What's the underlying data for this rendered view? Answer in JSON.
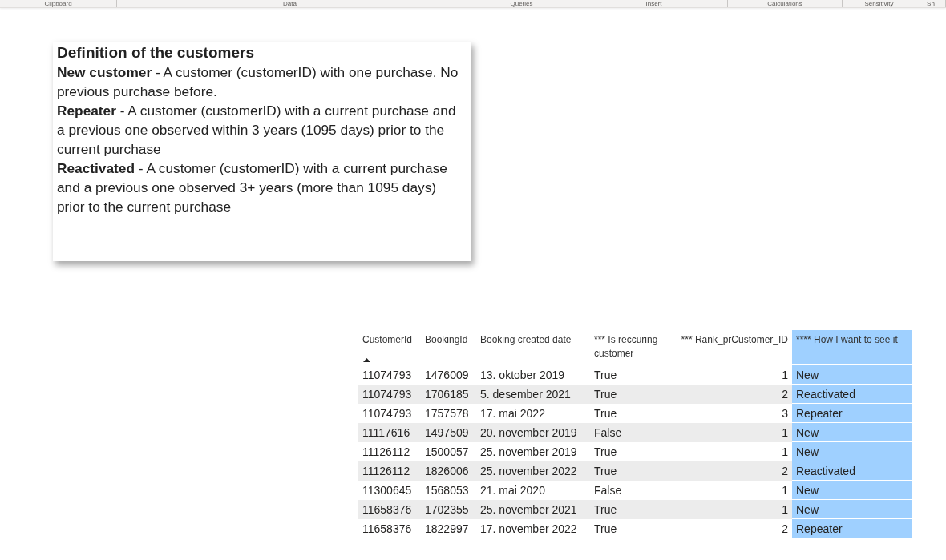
{
  "ribbon": {
    "groups": [
      "Clipboard",
      "Data",
      "Queries",
      "Insert",
      "Calculations",
      "Sensitivity",
      "Sh"
    ]
  },
  "definitions": {
    "title": "Definition of the customers",
    "paragraphs": [
      "**New customer** - A customer (customerID) with one purchase. No previous purchase before.",
      "**Repeater** - A customer (customerID) with a current purchase and a previous one observed within 3 years (1095 days) prior to the current purchase",
      "**Reactivated** - A customer (customerID) with a current purchase and a previous one observed 3+ years (more than 1095 days) prior to the current purchase"
    ]
  },
  "table": {
    "columns": [
      {
        "label": "CustomerId",
        "sorted": true,
        "highlighted": false,
        "kind": "text"
      },
      {
        "label": "BookingId",
        "sorted": false,
        "highlighted": false,
        "kind": "text"
      },
      {
        "label": "Booking created date",
        "sorted": false,
        "highlighted": false,
        "kind": "text"
      },
      {
        "label": "*** Is reccuring customer",
        "sorted": false,
        "highlighted": false,
        "kind": "text"
      },
      {
        "label": "*** Rank_prCustomer_ID",
        "sorted": false,
        "highlighted": false,
        "kind": "number"
      },
      {
        "label": "**** How I want to see it",
        "sorted": false,
        "highlighted": true,
        "kind": "text"
      }
    ],
    "rows": [
      [
        "11074793",
        "1476009",
        "13. oktober 2019",
        "True",
        "1",
        "New"
      ],
      [
        "11074793",
        "1706185",
        "5. desember 2021",
        "True",
        "2",
        "Reactivated"
      ],
      [
        "11074793",
        "1757578",
        "17. mai 2022",
        "True",
        "3",
        "Repeater"
      ],
      [
        "11117616",
        "1497509",
        "20. november 2019",
        "False",
        "1",
        "New"
      ],
      [
        "11126112",
        "1500057",
        "25. november 2019",
        "True",
        "1",
        "New"
      ],
      [
        "11126112",
        "1826006",
        "25. november 2022",
        "True",
        "2",
        "Reactivated"
      ],
      [
        "11300645",
        "1568053",
        "21. mai 2020",
        "False",
        "1",
        "New"
      ],
      [
        "11658376",
        "1702355",
        "25. november 2021",
        "True",
        "1",
        "New"
      ],
      [
        "11658376",
        "1822997",
        "17. november 2022",
        "True",
        "2",
        "Repeater"
      ]
    ]
  }
}
